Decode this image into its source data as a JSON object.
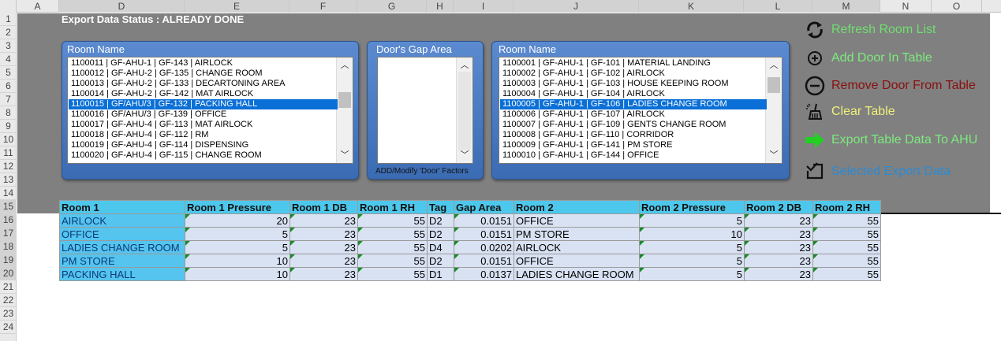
{
  "columns": [
    "A",
    "D",
    "E",
    "F",
    "G",
    "H",
    "I",
    "J",
    "K",
    "L",
    "M",
    "N",
    "O"
  ],
  "rows": [
    "1",
    "2",
    "3",
    "4",
    "5",
    "6",
    "7",
    "8",
    "9",
    "10",
    "11",
    "12",
    "13",
    "14",
    "15",
    "16",
    "17",
    "18",
    "19",
    "20",
    "21",
    "22",
    "23",
    "24"
  ],
  "export_status": "Export Data Status : ALREADY DONE",
  "left_list": {
    "title": "Room Name",
    "items": [
      "1100011 | GF-AHU-1 | GF-143 | AIRLOCK",
      "1100012 | GF-AHU-2 | GF-135 | CHANGE ROOM",
      "1100013 | GF-AHU-2 | GF-133 | DECARTONING AREA",
      "1100014 | GF-AHU-2 | GF-142 | MAT AIRLOCK",
      "1100015 | GF/AHU/3 | GF-132 | PACKING HALL",
      "1100016 | GF/AHU/3 | GF-139 | OFFICE",
      "1100017 | GF-AHU-4 | GF-113 | MAT AIRLOCK",
      "1100018 | GF-AHU-4 | GF-112 | RM",
      "1100019 | GF-AHU-4 | GF-114 | DISPENSING",
      "1100020 | GF-AHU-4 | GF-115 | CHANGE ROOM"
    ],
    "selected_index": 4
  },
  "gap_list": {
    "title": "Door's Gap Area",
    "footer": "ADD/Modify 'Door' Factors"
  },
  "right_list": {
    "title": "Room Name",
    "items": [
      "1100001 | GF-AHU-1 | GF-101 | MATERIAL LANDING",
      "1100002 | GF-AHU-1 | GF-102 | AIRLOCK",
      "1100003 | GF-AHU-1 | GF-103 | HOUSE KEEPING ROOM",
      "1100004 | GF-AHU-1 | GF-104 | AIRLOCK",
      "1100005 | GF-AHU-1 | GF-106 | LADIES CHANGE ROOM",
      "1100006 | GF-AHU-1 | GF-107 | AIRLOCK",
      "1100007 | GF-AHU-1 | GF-109 | GENTS CHANGE ROOM",
      "1100008 | GF-AHU-1 | GF-110 | CORRIDOR",
      "1100009 | GF-AHU-1 | GF-141 | PM STORE",
      "1100010 | GF-AHU-1 | GF-144 | OFFICE"
    ],
    "selected_index": 4
  },
  "buttons": {
    "refresh": "Refresh Room List",
    "add": "Add Door In Table",
    "remove": "Remove Door From Table",
    "clear": "Clear Table",
    "export": "Export Table Data To AHU",
    "selected": "Selected Export Data"
  },
  "colors": {
    "refresh": "#6fe06f",
    "add": "#7dea7d",
    "remove": "#8b1010",
    "clear": "#f0f07a",
    "export": "#7dea7d",
    "selected": "#2a8ad4"
  },
  "table": {
    "headers": [
      "Room 1",
      "Room 1 Pressure",
      "Room 1 DB",
      "Room 1 RH",
      "Tag",
      "Gap Area",
      "Room 2",
      "Room 2 Pressure",
      "Room 2 DB",
      "Room 2 RH"
    ],
    "rows": [
      [
        "AIRLOCK",
        "20",
        "23",
        "55",
        "D2",
        "0.0151",
        "OFFICE",
        "5",
        "23",
        "55"
      ],
      [
        "OFFICE",
        "5",
        "23",
        "55",
        "D2",
        "0.0151",
        "PM STORE",
        "10",
        "23",
        "55"
      ],
      [
        "LADIES CHANGE ROOM",
        "5",
        "23",
        "55",
        "D4",
        "0.0202",
        "AIRLOCK",
        "5",
        "23",
        "55"
      ],
      [
        "PM STORE",
        "10",
        "23",
        "55",
        "D2",
        "0.0151",
        "OFFICE",
        "5",
        "23",
        "55"
      ],
      [
        "PACKING HALL",
        "10",
        "23",
        "55",
        "D1",
        "0.0137",
        "LADIES CHANGE ROOM",
        "5",
        "23",
        "55"
      ]
    ]
  }
}
